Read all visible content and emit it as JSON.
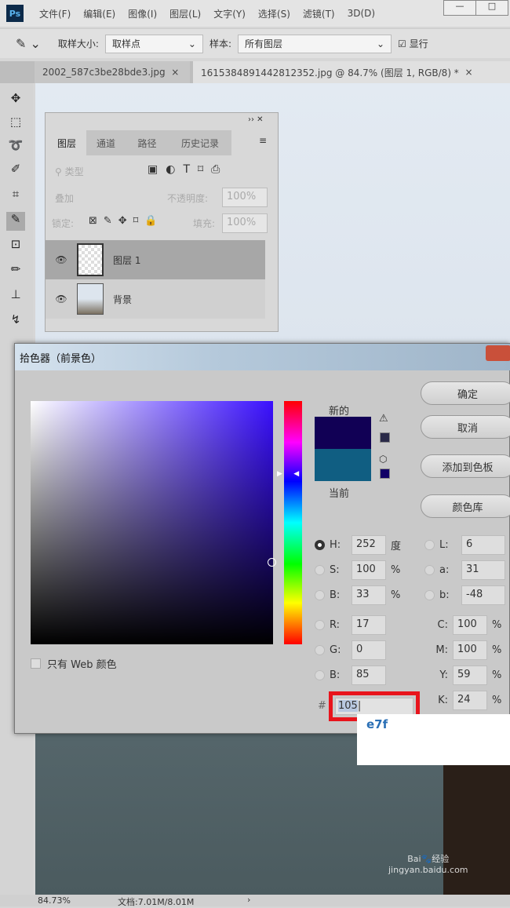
{
  "menu": {
    "logo": "Ps",
    "items": [
      "文件(F)",
      "编辑(E)",
      "图像(I)",
      "图层(L)",
      "文字(Y)",
      "选择(S)",
      "滤镜(T)",
      "3D(D)"
    ]
  },
  "options": {
    "sample_size_label": "取样大小:",
    "sample_size_value": "取样点",
    "sample_label": "样本:",
    "sample_value": "所有图层",
    "show_label": "显行"
  },
  "tabs": [
    {
      "label": "2002_587c3be28bde3.jpg",
      "close": "×"
    },
    {
      "label": "1615384891442812352.jpg @ 84.7% (图层 1, RGB/8) *",
      "close": "×"
    }
  ],
  "layers_panel": {
    "tabs": [
      "图层",
      "通道",
      "路径",
      "历史记录"
    ],
    "filter_placeholder": "类型",
    "blend_mode": "叠加",
    "opacity_label": "不透明度:",
    "opacity_value": "100%",
    "lock_label": "锁定:",
    "fill_label": "填充:",
    "fill_value": "100%",
    "layers": [
      {
        "name": "图层 1",
        "selected": true
      },
      {
        "name": "背景",
        "selected": false
      }
    ]
  },
  "color_picker": {
    "title": "拾色器（前景色）",
    "new_label": "新的",
    "current_label": "当前",
    "new_color": "#110055",
    "current_color": "#105e82",
    "buttons": {
      "ok": "确定",
      "cancel": "取消",
      "add_swatch": "添加到色板",
      "libraries": "颜色库"
    },
    "hsb": [
      {
        "label": "H:",
        "value": "252",
        "unit": "度"
      },
      {
        "label": "S:",
        "value": "100",
        "unit": "%"
      },
      {
        "label": "B:",
        "value": "33",
        "unit": "%"
      }
    ],
    "rgb": [
      {
        "label": "R:",
        "value": "17"
      },
      {
        "label": "G:",
        "value": "0"
      },
      {
        "label": "B:",
        "value": "85"
      }
    ],
    "lab": [
      {
        "label": "L:",
        "value": "6"
      },
      {
        "label": "a:",
        "value": "31"
      },
      {
        "label": "b:",
        "value": "-48"
      }
    ],
    "cmyk": [
      {
        "label": "C:",
        "value": "100",
        "unit": "%"
      },
      {
        "label": "M:",
        "value": "100",
        "unit": "%"
      },
      {
        "label": "Y:",
        "value": "59",
        "unit": "%"
      },
      {
        "label": "K:",
        "value": "24",
        "unit": "%"
      }
    ],
    "hex_label": "#",
    "hex_value": "105",
    "web_only_label": "只有 Web 颜色",
    "highlight_color": "#e8141c"
  },
  "overlay_text": "e7f",
  "status": {
    "zoom": "84.73%",
    "doc": "文档:7.01M/8.01M",
    "arrow": "›"
  },
  "watermark": "Bai 经验 jingyan.baidu.com"
}
